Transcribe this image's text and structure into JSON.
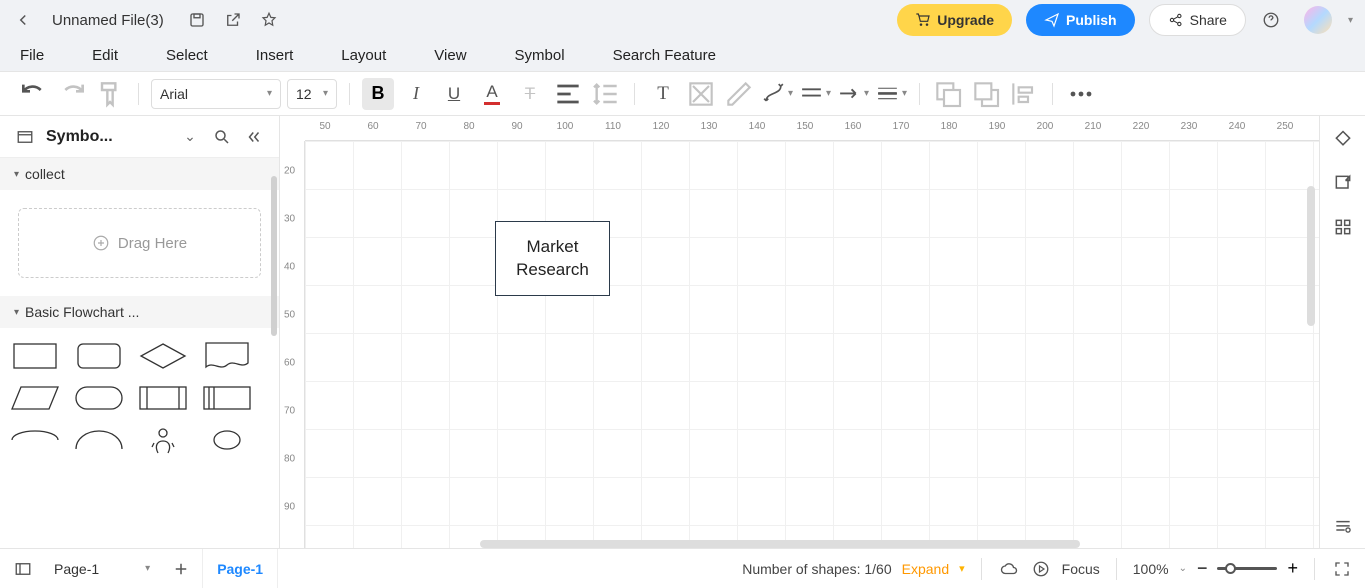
{
  "header": {
    "file_title": "Unnamed File(3)",
    "upgrade": "Upgrade",
    "publish": "Publish",
    "share": "Share"
  },
  "menu": [
    "File",
    "Edit",
    "Select",
    "Insert",
    "Layout",
    "View",
    "Symbol",
    "Search Feature"
  ],
  "toolbar": {
    "font": "Arial",
    "size": "12"
  },
  "left_panel": {
    "title": "Symbo...",
    "section_collect": "collect",
    "drag_here": "Drag Here",
    "section_flowchart": "Basic Flowchart ..."
  },
  "canvas": {
    "shape_text": "Market\nResearch",
    "ruler_h": [
      "50",
      "60",
      "70",
      "80",
      "90",
      "100",
      "110",
      "120",
      "130",
      "140",
      "150",
      "160",
      "170",
      "180",
      "190",
      "200",
      "210",
      "220",
      "230",
      "240",
      "250"
    ],
    "ruler_v": [
      "20",
      "30",
      "40",
      "50",
      "60",
      "70",
      "80",
      "90"
    ]
  },
  "status": {
    "page_selector": "Page-1",
    "page_tab": "Page-1",
    "shapes_count": "Number of shapes: 1/60",
    "expand": "Expand",
    "focus": "Focus",
    "zoom": "100%"
  }
}
